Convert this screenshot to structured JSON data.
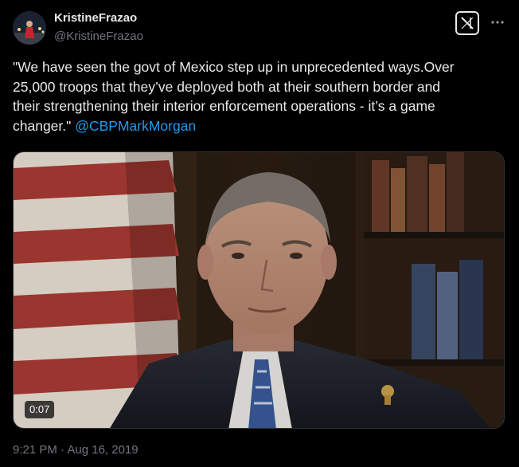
{
  "tweet": {
    "author": {
      "display_name": "KristineFrazao",
      "handle": "@KristineFrazao",
      "avatar_icon": "profile-photo"
    },
    "header_icons": {
      "brand": "x-logo-icon",
      "more": "more-options-icon"
    },
    "text_lines": [
      "\"We have seen the govt of Mexico step up in unprecedented ways.Over",
      "25,000 troops that they’ve deployed both at their southern border and",
      "their strengthening their interior enforcement operations - it’s a game",
      "changer.\" "
    ],
    "mention": "@CBPMarkMorgan",
    "media": {
      "type": "video",
      "duration": "0:07"
    },
    "timestamp": "9:21 PM · Aug 16, 2019"
  },
  "colors": {
    "background": "#000000",
    "text_primary": "#e7e9ea",
    "text_secondary": "#71767b",
    "link": "#1d9bf0",
    "border": "#2f3336"
  }
}
